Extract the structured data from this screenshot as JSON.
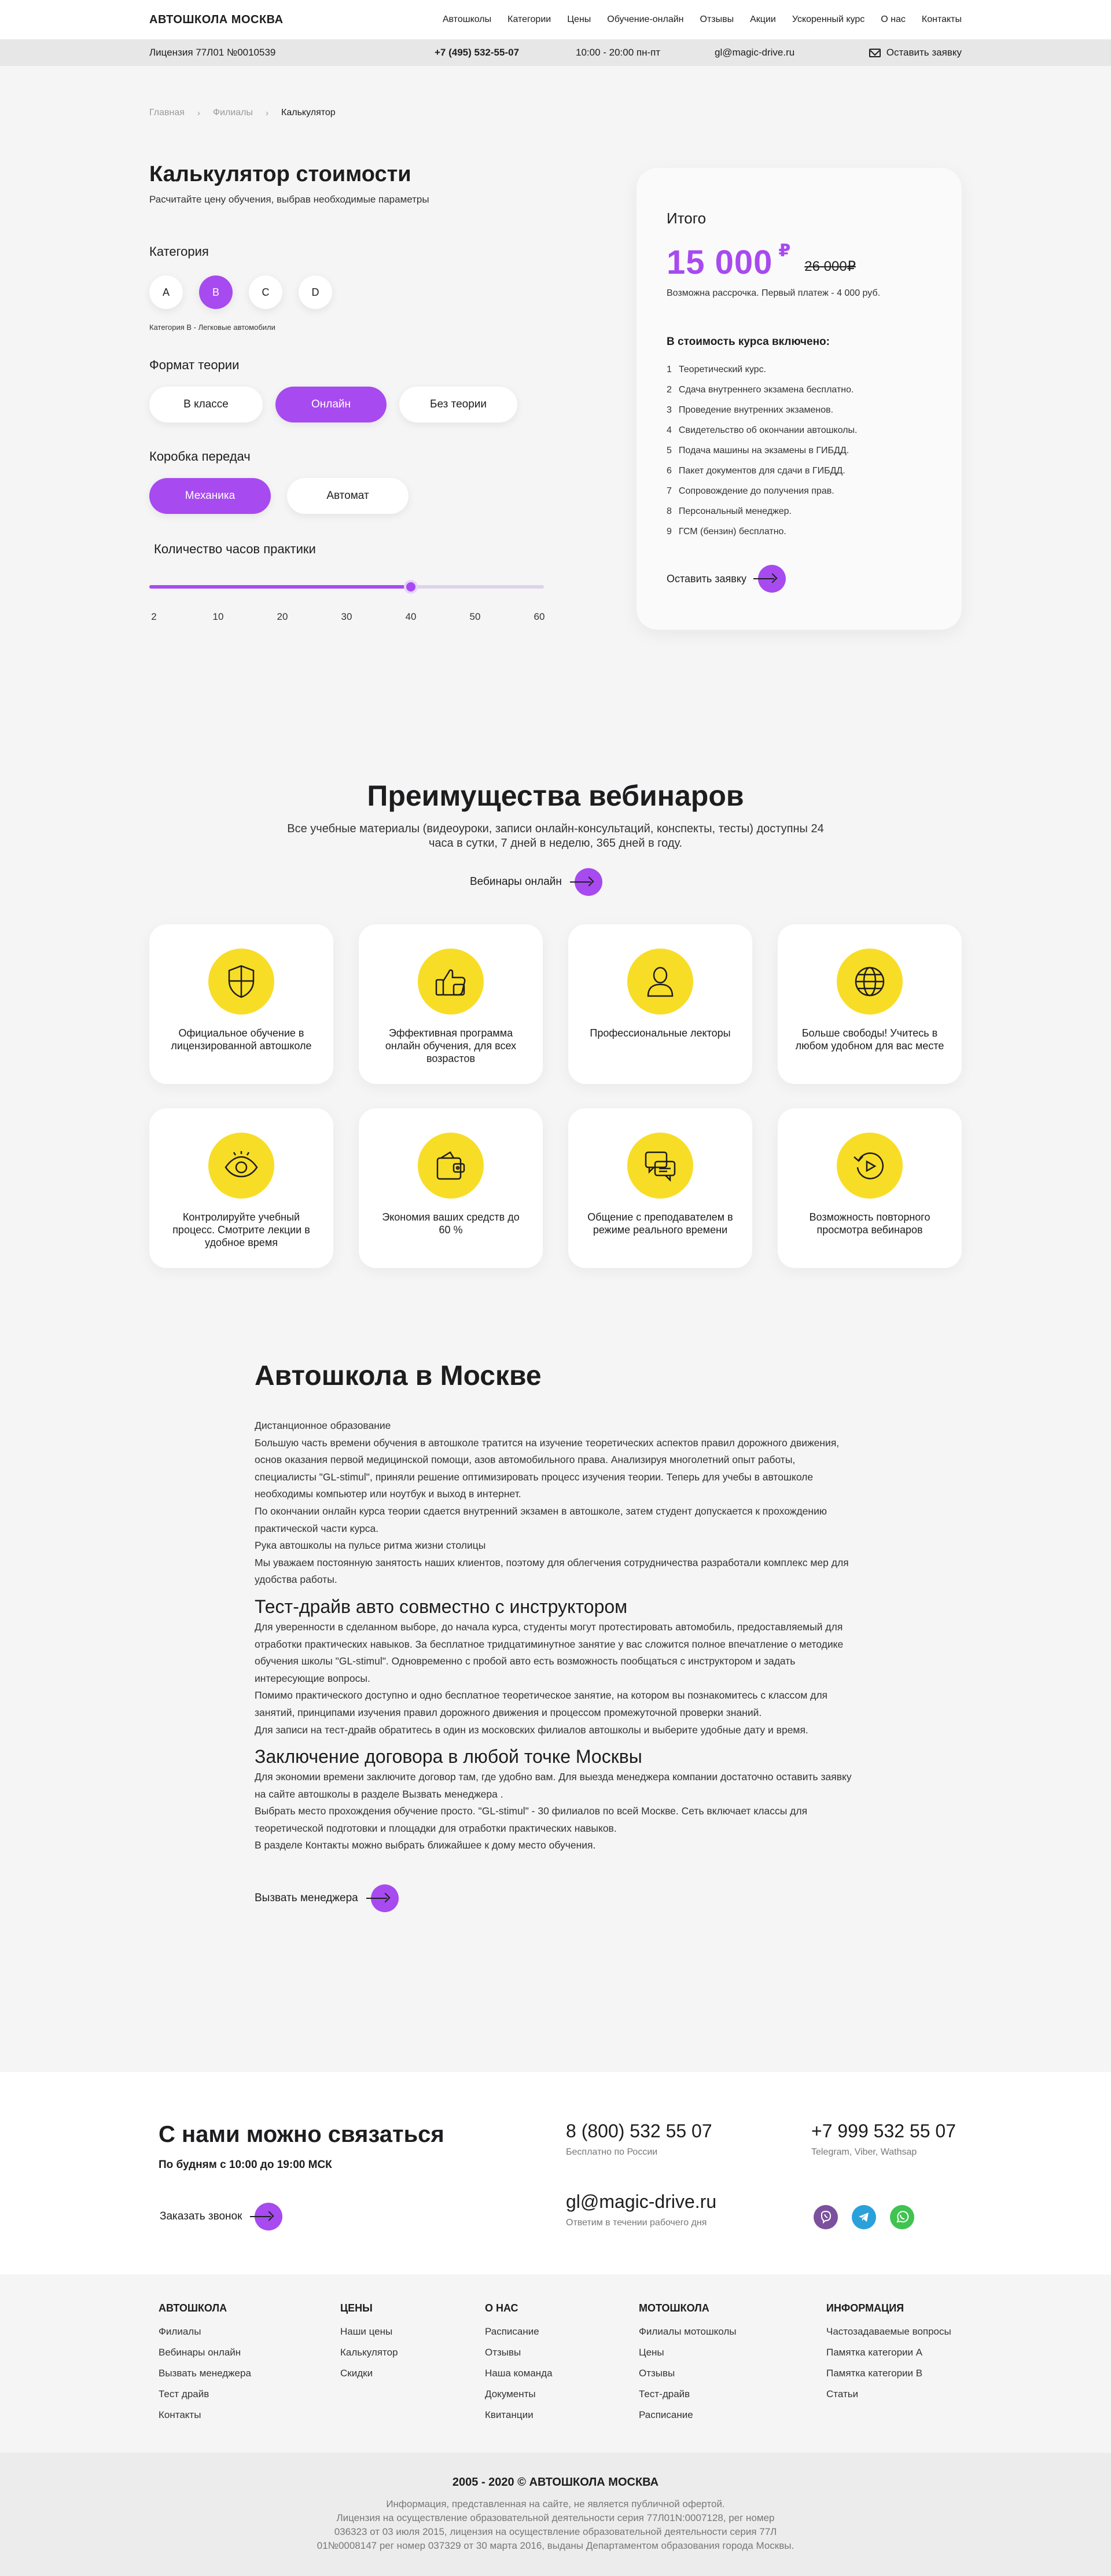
{
  "header": {
    "logo": "АВТОШКОЛА МОСКВА",
    "nav": [
      "Автошколы",
      "Категории",
      "Цены",
      "Обучение-онлайн",
      "Отзывы",
      "Акции",
      "Ускоренный курс",
      "О нас",
      "Контакты"
    ],
    "license": "Лицензия 77Л01 №0010539",
    "phone": "+7 (495) 532-55-07",
    "hours": "10:00 - 20:00 пн-пт",
    "email": "gl@magic-drive.ru",
    "cta": "Оставить заявку"
  },
  "breadcrumb": {
    "items": [
      "Главная",
      "Филиалы",
      "Калькулятор"
    ]
  },
  "calculator": {
    "title": "Калькулятор стоимости",
    "subtitle": "Расчитайте цену обучения, выбрав необходимые параметры",
    "category_label": "Категория",
    "categories": [
      "A",
      "B",
      "C",
      "D"
    ],
    "category_selected": "B",
    "category_note": "Категория B - Легковые автомобили",
    "theory_label": "Формат теории",
    "theory_options": [
      "В классе",
      "Онлайн",
      "Без теории"
    ],
    "theory_selected": "Онлайн",
    "gearbox_label": "Коробка передач",
    "gearbox_options": [
      "Механика",
      "Автомат"
    ],
    "gearbox_selected": "Механика",
    "hours_label": "Количество часов практики",
    "hours_ticks": [
      "2",
      "10",
      "20",
      "30",
      "40",
      "50",
      "60"
    ],
    "hours_value": 40
  },
  "summary": {
    "title": "Итого",
    "price": "15 000",
    "currency": "₽",
    "old_price": "26 000₽",
    "installment": "Возможна рассрочка. Первый платеж - 4 000 руб.",
    "included_title": "В стоимость курса включено:",
    "included": [
      "Теоретический курс.",
      "Сдача внутреннего экзамена бесплатно.",
      "Проведение внутренних экзаменов.",
      "Свидетельство об окончании автошколы.",
      "Подача машины на экзамены в ГИБДД.",
      "Пакет документов для сдачи в ГИБДД.",
      "Сопровождение до получения прав.",
      "Персональный менеджер.",
      "ГСМ (бензин) бесплатно."
    ],
    "cta": "Оставить заявку"
  },
  "advantages": {
    "title": "Преимущества вебинаров",
    "subtitle": "Все учебные материалы (видеоуроки, записи онлайн-консультаций, конспекты, тесты) доступны 24 часа в сутки, 7 дней в неделю, 365 дней в году.",
    "link": "Вебинары онлайн",
    "items": [
      {
        "icon": "shield-icon",
        "text": "Официальное обучение в лицензированной автошколе"
      },
      {
        "icon": "thumbs-up-icon",
        "text": "Эффективная программа онлайн обучения, для всех возрастов"
      },
      {
        "icon": "lecturer-icon",
        "text": "Профессиональные лекторы"
      },
      {
        "icon": "globe-icon",
        "text": "Больше свободы! Учитесь в любом удобном для вас месте"
      },
      {
        "icon": "eye-icon",
        "text": "Контролируйте учебный процесс. Смотрите лекции в удобное время"
      },
      {
        "icon": "wallet-icon",
        "text": "Экономия ваших средств до 60 %"
      },
      {
        "icon": "chat-icon",
        "text": "Общение с преподавателем в режиме реального времени"
      },
      {
        "icon": "replay-icon",
        "text": "Возможность повторного просмотра вебинаров"
      }
    ]
  },
  "article": {
    "title": "Автошкола в Москве",
    "intro": "Дистанционное образование\nБольшую часть времени обучения в автошколе тратится на изучение теоретических аспектов правил дорожного движения, основ оказания первой медицинской помощи, азов автомобильного права. Анализируя многолетний опыт работы, специалисты \"GL-stimul\", приняли решение оптимизировать процесс изучения теории. Теперь для учебы в автошколе необходимы компьютер или ноутбук и выход в интернет.\nПо окончании онлайн курса теории сдается внутренний экзамен в автошколе, затем студент допускается к прохождению практической части курса.\nРука автошколы на пульсе ритма жизни столицы\nМы уважаем постоянную занятость наших клиентов, поэтому для облегчения сотрудничества разработали комплекс мер для удобства работы.",
    "h_test": "Тест-драйв авто совместно с инструктором",
    "test": "Для уверенности в сделанном выборе, до начала курса, студенты могут протестировать автомобиль, предоставляемый для отработки практических навыков. За бесплатное тридцатиминутное занятие у вас сложится полное впечатление о методике обучения школы \"GL-stimul\". Одновременно с пробой авто есть возможность пообщаться с инструктором и задать интересующие вопросы.\nПомимо практического доступно и одно бесплатное теоретическое занятие, на котором вы познакомитесь с классом для занятий, принципами изучения правил дорожного движения и процессом промежуточной проверки знаний.\nДля записи на тест-драйв обратитесь в один из московских филиалов автошколы и выберите удобные дату и время.",
    "h_contract": "Заключение договора в любой точке Москвы",
    "contract": "Для экономии времени заключите договор там, где удобно вам. Для выезда менеджера компании достаточно оставить заявку на сайте автошколы в разделе Вызвать менеджера .\nВыбрать место прохождения обучение просто. \"GL-stimul\" - 30 филиалов по всей Москве. Сеть включает классы для теоретической подготовки и площадки для отработки практических навыков.\nВ разделе Контакты можно выбрать ближайшее к дому место обучения.",
    "manager_cta": "Вызвать менеджера"
  },
  "contacts": {
    "title": "С нами можно связаться",
    "hours": "По будням с 10:00 до 19:00 МСК",
    "call_cta": "Заказать звонок",
    "phone1": "8 (800) 532 55 07",
    "phone1_note": "Бесплатно по России",
    "phone2": "+7 999 532 55 07",
    "phone2_note": "Telegram, Viber, Wathsap",
    "email": "gl@magic-drive.ru",
    "email_note": "Ответим в течении рабочего дня",
    "colors": {
      "viber": "#7b519d",
      "telegram": "#2aa1da",
      "whatsapp": "#3fc351"
    }
  },
  "footer": {
    "columns": [
      {
        "title": "АВТОШКОЛА",
        "links": [
          "Филиалы",
          "Вебинары онлайн",
          "Вызвать менеджера",
          "Тест драйв",
          "Контакты"
        ]
      },
      {
        "title": "ЦЕНЫ",
        "links": [
          "Наши цены",
          "Калькулятор",
          "Скидки"
        ]
      },
      {
        "title": "О НАС",
        "links": [
          "Расписание",
          "Отзывы",
          "Наша команда",
          "Документы",
          "Квитанции"
        ]
      },
      {
        "title": "МОТОШКОЛА",
        "links": [
          "Филиалы мотошколы",
          "Цены",
          "Отзывы",
          "Тест-драйв",
          "Расписание"
        ]
      },
      {
        "title": "ИНФОРМАЦИЯ",
        "links": [
          "Частозадаваемые вопросы",
          "Памятка категории A",
          "Памятка категории B",
          "Статьи"
        ]
      }
    ],
    "copyright": "2005 - 2020 © АВТОШКОЛА МОСКВА",
    "legal": "Информация, представленная на сайте, не является публичной офертой.\nЛицензия на осуществление образовательной деятельности серия 77Л01N:0007128, рег номер\n036323 от 03 июля 2015, лицензия на осуществление образовательной деятельности серия 77Л\n01№0008147 рег номер 037329 от 30 марта 2016, выданы Департаментом образования города Москвы."
  },
  "colors": {
    "accent": "#a74aef",
    "icon_bg": "#f8dd27",
    "page_bg": "#f5f5f5"
  }
}
